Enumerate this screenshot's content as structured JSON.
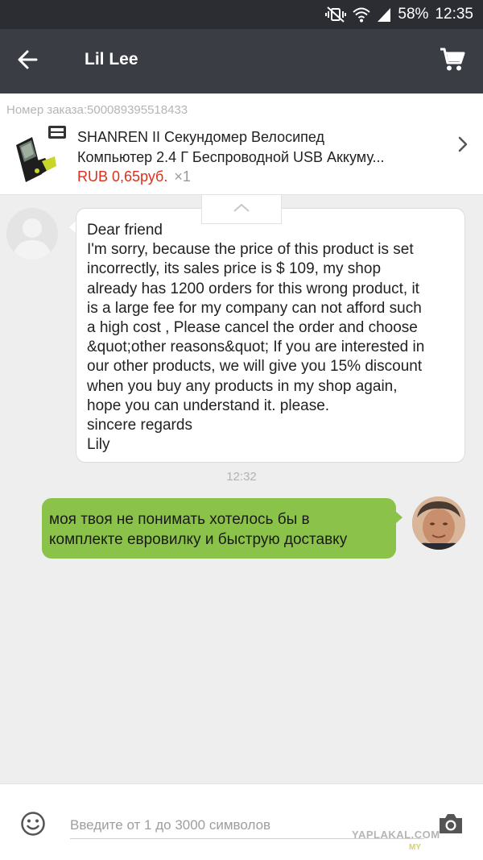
{
  "status_bar": {
    "battery": "58%",
    "time": "12:35",
    "icons": [
      "vibrate-off-icon",
      "wifi-icon",
      "signal-icon"
    ]
  },
  "app_bar": {
    "title": "Lil Lee",
    "back_icon": "arrow-left-icon",
    "cart_icon": "cart-icon"
  },
  "order": {
    "number_label": "Номер заказа:500089395518433",
    "title_line1": "SHANREN II Секундомер Велосипед",
    "title_line2": "Компьютер 2.4 Г Беспроводной USB Аккуму...",
    "price": "RUB 0,65руб.",
    "quantity": "×1"
  },
  "messages": [
    {
      "direction": "incoming",
      "lines": [
        "Dear friend",
        "I'm sorry, because the price of this product is set",
        "incorrectly, its sales price is $ 109, my shop",
        "already has 1200 orders for this wrong product, it",
        "is a large fee for my company can not afford such",
        "a high cost , Please cancel the order and choose",
        "&quot;other reasons&quot; If you are interested in",
        "our other products, we will give you 15% discount",
        "when you buy any products in my shop again,",
        "hope you can understand it. please.",
        "sincere regards",
        "Lily"
      ]
    },
    {
      "direction": "outgoing",
      "lines": [
        "моя твоя не понимать хотелось бы в",
        "комплекте евровилку и быструю доставку"
      ]
    }
  ],
  "timestamp": "12:32",
  "input": {
    "placeholder": "Введите от 1 до 3000 символов"
  },
  "watermark": {
    "main": "YAPLAKAL.COM",
    "sub": "MY"
  },
  "colors": {
    "status_bar": "#2b2d33",
    "app_bar": "#3a3d44",
    "price": "#e02e1b",
    "outgoing_bubble": "#8bc34a",
    "chat_background": "#eeeeee"
  }
}
